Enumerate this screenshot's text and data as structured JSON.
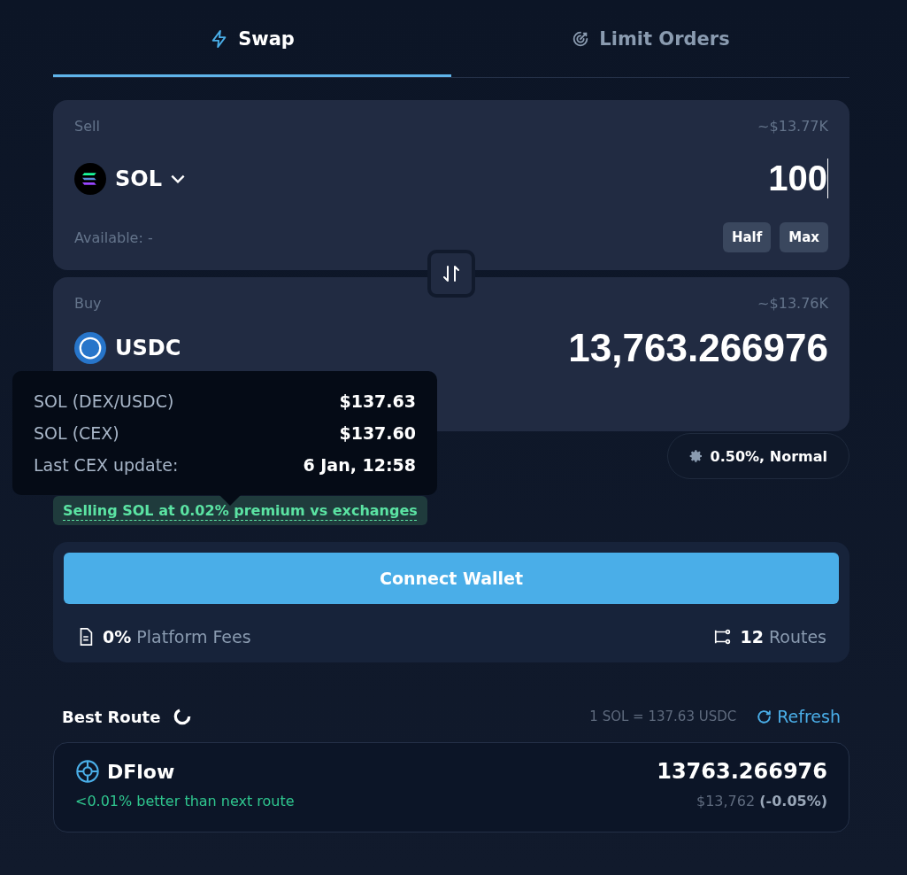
{
  "tabs": [
    {
      "label": "Swap",
      "selected": true
    },
    {
      "label": "Limit Orders",
      "selected": false
    }
  ],
  "sell": {
    "label": "Sell",
    "usd": "~$13.77K",
    "token": "SOL",
    "amount": "100",
    "available": "Available: -",
    "buttons": [
      "Half",
      "Max"
    ]
  },
  "buy": {
    "label": "Buy",
    "usd": "~$13.76K",
    "token": "USDC",
    "amount": "13,763.266976"
  },
  "tooltip": [
    {
      "label": "SOL (DEX/USDC)",
      "value": "$137.63"
    },
    {
      "label": "SOL (CEX)",
      "value": "$137.60"
    },
    {
      "label": "Last CEX update:",
      "value": "6 Jan, 12:58"
    }
  ],
  "slippage": "0.50%, Normal",
  "premium": "Selling SOL at 0.02% premium vs exchanges",
  "wallet": {
    "button": "Connect Wallet",
    "fees": {
      "value": "0%",
      "label": "Platform Fees"
    },
    "routes": {
      "value": "12",
      "label": "Routes"
    }
  },
  "best_route": {
    "title": "Best Route",
    "rate": "1 SOL = 137.63 USDC",
    "refresh": "Refresh",
    "route": {
      "name": "DFlow",
      "note": "<0.01% better than next route",
      "amount": "13763.266976",
      "usd": "$13,762",
      "change": "(-0.05%)"
    }
  }
}
